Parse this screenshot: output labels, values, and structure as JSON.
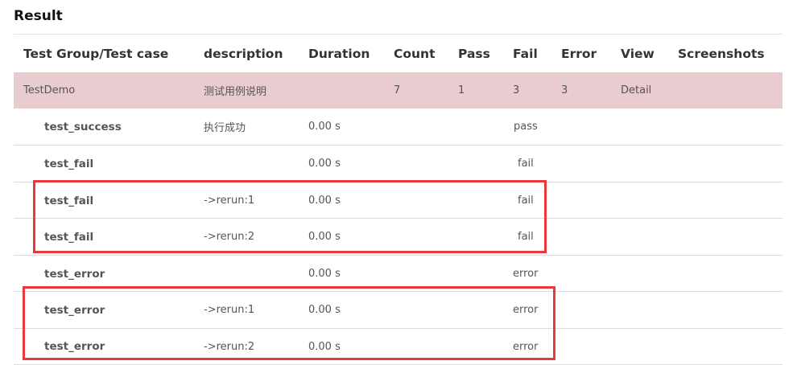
{
  "title": "Result",
  "columns": [
    "Test Group/Test case",
    "description",
    "Duration",
    "Count",
    "Pass",
    "Fail",
    "Error",
    "View",
    "Screenshots"
  ],
  "group": {
    "name": "TestDemo",
    "description": "测试用例说明",
    "count": "7",
    "pass": "1",
    "fail": "3",
    "error": "3",
    "view": "Detail"
  },
  "cases": [
    {
      "name": "test_success",
      "description": "执行成功",
      "duration": "0.00 s",
      "status": "pass",
      "status_type": "pass"
    },
    {
      "name": "test_fail",
      "description": "",
      "duration": "0.00 s",
      "status": "fail",
      "status_type": "fail"
    },
    {
      "name": "test_fail",
      "description": "->rerun:1",
      "duration": "0.00 s",
      "status": "fail",
      "status_type": "fail"
    },
    {
      "name": "test_fail",
      "description": "->rerun:2",
      "duration": "0.00 s",
      "status": "fail",
      "status_type": "fail"
    },
    {
      "name": "test_error",
      "description": "",
      "duration": "0.00 s",
      "status": "error",
      "status_type": "error"
    },
    {
      "name": "test_error",
      "description": "->rerun:1",
      "duration": "0.00 s",
      "status": "error",
      "status_type": "error"
    },
    {
      "name": "test_error",
      "description": "->rerun:2",
      "duration": "0.00 s",
      "status": "error",
      "status_type": "error"
    }
  ],
  "colors": {
    "pass": "#2e9c3a",
    "fail": "#d0731c",
    "error": "#c0261e",
    "link": "#4ab3c2",
    "group_bg": "#e8ccd0",
    "highlight": "#e8393d"
  }
}
